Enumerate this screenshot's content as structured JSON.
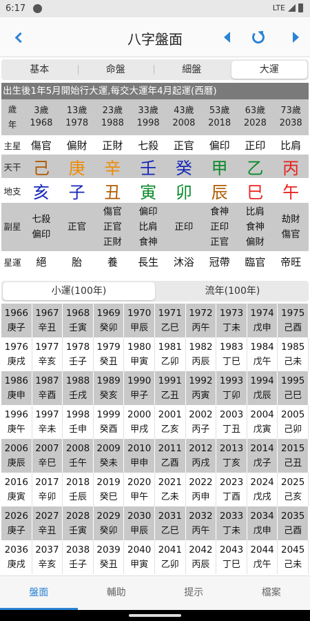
{
  "status": {
    "time": "6:17",
    "network": "LTE"
  },
  "appbar": {
    "title": "八字盤面"
  },
  "tabs": [
    "基本",
    "命盤",
    "細盤",
    "大運"
  ],
  "luck": {
    "header": "出生後1年5月開始行大運,每交大運年4月起運(西曆)",
    "age_label": [
      "歲",
      "年"
    ],
    "ages": [
      {
        "age": "3歲",
        "year": "1968"
      },
      {
        "age": "13歲",
        "year": "1978"
      },
      {
        "age": "23歲",
        "year": "1988"
      },
      {
        "age": "33歲",
        "year": "1998"
      },
      {
        "age": "43歲",
        "year": "2008"
      },
      {
        "age": "53歲",
        "year": "2018"
      },
      {
        "age": "63歲",
        "year": "2028"
      },
      {
        "age": "73歲",
        "year": "2038"
      }
    ],
    "main_label": "主星",
    "main": [
      "傷官",
      "偏財",
      "正財",
      "七殺",
      "正官",
      "偏印",
      "正印",
      "比肩"
    ],
    "stem_label": "天干",
    "stems": [
      {
        "char": "己",
        "color": "#b05a00"
      },
      {
        "char": "庚",
        "color": "#f08a00"
      },
      {
        "char": "辛",
        "color": "#f08a00"
      },
      {
        "char": "壬",
        "color": "#1527b8"
      },
      {
        "char": "癸",
        "color": "#1527b8"
      },
      {
        "char": "甲",
        "color": "#0a8a2a"
      },
      {
        "char": "乙",
        "color": "#0a8a2a"
      },
      {
        "char": "丙",
        "color": "#e8231f"
      }
    ],
    "branch_label": "地支",
    "branches": [
      {
        "char": "亥",
        "color": "#1527b8"
      },
      {
        "char": "子",
        "color": "#1527b8"
      },
      {
        "char": "丑",
        "color": "#b05a00"
      },
      {
        "char": "寅",
        "color": "#0a8a2a"
      },
      {
        "char": "卯",
        "color": "#0a8a2a"
      },
      {
        "char": "辰",
        "color": "#b05a00"
      },
      {
        "char": "巳",
        "color": "#e8231f"
      },
      {
        "char": "午",
        "color": "#e8231f"
      }
    ],
    "sub_label": "副星",
    "sub": [
      [
        "七殺",
        "偏印",
        ""
      ],
      [
        "正官",
        "",
        ""
      ],
      [
        "傷官",
        "正官",
        "正財"
      ],
      [
        "偏印",
        "比肩",
        "食神"
      ],
      [
        "正印",
        "",
        ""
      ],
      [
        "食神",
        "正印",
        "正官"
      ],
      [
        "比肩",
        "食神",
        "偏財"
      ],
      [
        "劫財",
        "傷官",
        ""
      ]
    ],
    "stage_label": "星運",
    "stages": [
      "絕",
      "胎",
      "養",
      "長生",
      "沐浴",
      "冠帶",
      "臨官",
      "帝旺"
    ]
  },
  "subtabs": [
    "小運(100年)",
    "流年(100年)"
  ],
  "years": [
    [
      {
        "y": "1966",
        "gz": "庚子"
      },
      {
        "y": "1967",
        "gz": "辛丑"
      },
      {
        "y": "1968",
        "gz": "壬寅"
      },
      {
        "y": "1969",
        "gz": "癸卯"
      },
      {
        "y": "1970",
        "gz": "甲辰"
      },
      {
        "y": "1971",
        "gz": "乙巳"
      },
      {
        "y": "1972",
        "gz": "丙午"
      },
      {
        "y": "1973",
        "gz": "丁未"
      },
      {
        "y": "1974",
        "gz": "戊申"
      },
      {
        "y": "1975",
        "gz": "己酉"
      }
    ],
    [
      {
        "y": "1976",
        "gz": "庚戌"
      },
      {
        "y": "1977",
        "gz": "辛亥"
      },
      {
        "y": "1978",
        "gz": "壬子"
      },
      {
        "y": "1979",
        "gz": "癸丑"
      },
      {
        "y": "1980",
        "gz": "甲寅"
      },
      {
        "y": "1981",
        "gz": "乙卯"
      },
      {
        "y": "1982",
        "gz": "丙辰"
      },
      {
        "y": "1983",
        "gz": "丁巳"
      },
      {
        "y": "1984",
        "gz": "戊午"
      },
      {
        "y": "1985",
        "gz": "己未"
      }
    ],
    [
      {
        "y": "1986",
        "gz": "庚申"
      },
      {
        "y": "1987",
        "gz": "辛酉"
      },
      {
        "y": "1988",
        "gz": "壬戌"
      },
      {
        "y": "1989",
        "gz": "癸亥"
      },
      {
        "y": "1990",
        "gz": "甲子"
      },
      {
        "y": "1991",
        "gz": "乙丑"
      },
      {
        "y": "1992",
        "gz": "丙寅"
      },
      {
        "y": "1993",
        "gz": "丁卯"
      },
      {
        "y": "1994",
        "gz": "戊辰"
      },
      {
        "y": "1995",
        "gz": "己巳"
      }
    ],
    [
      {
        "y": "1996",
        "gz": "庚午"
      },
      {
        "y": "1997",
        "gz": "辛未"
      },
      {
        "y": "1998",
        "gz": "壬申"
      },
      {
        "y": "1999",
        "gz": "癸酉"
      },
      {
        "y": "2000",
        "gz": "甲戌"
      },
      {
        "y": "2001",
        "gz": "乙亥"
      },
      {
        "y": "2002",
        "gz": "丙子"
      },
      {
        "y": "2003",
        "gz": "丁丑"
      },
      {
        "y": "2004",
        "gz": "戊寅"
      },
      {
        "y": "2005",
        "gz": "己卯"
      }
    ],
    [
      {
        "y": "2006",
        "gz": "庚辰"
      },
      {
        "y": "2007",
        "gz": "辛巳"
      },
      {
        "y": "2008",
        "gz": "壬午"
      },
      {
        "y": "2009",
        "gz": "癸未"
      },
      {
        "y": "2010",
        "gz": "甲申"
      },
      {
        "y": "2011",
        "gz": "乙酉"
      },
      {
        "y": "2012",
        "gz": "丙戌"
      },
      {
        "y": "2013",
        "gz": "丁亥"
      },
      {
        "y": "2014",
        "gz": "戊子"
      },
      {
        "y": "2015",
        "gz": "己丑"
      }
    ],
    [
      {
        "y": "2016",
        "gz": "庚寅"
      },
      {
        "y": "2017",
        "gz": "辛卯"
      },
      {
        "y": "2018",
        "gz": "壬辰"
      },
      {
        "y": "2019",
        "gz": "癸巳"
      },
      {
        "y": "2020",
        "gz": "甲午"
      },
      {
        "y": "2021",
        "gz": "乙未"
      },
      {
        "y": "2022",
        "gz": "丙申"
      },
      {
        "y": "2023",
        "gz": "丁酉"
      },
      {
        "y": "2024",
        "gz": "戊戌"
      },
      {
        "y": "2025",
        "gz": "己亥"
      }
    ],
    [
      {
        "y": "2026",
        "gz": "庚子"
      },
      {
        "y": "2027",
        "gz": "辛丑"
      },
      {
        "y": "2028",
        "gz": "壬寅"
      },
      {
        "y": "2029",
        "gz": "癸卯"
      },
      {
        "y": "2030",
        "gz": "甲辰"
      },
      {
        "y": "2031",
        "gz": "乙巳"
      },
      {
        "y": "2032",
        "gz": "丙午"
      },
      {
        "y": "2033",
        "gz": "丁未"
      },
      {
        "y": "2034",
        "gz": "戊申"
      },
      {
        "y": "2035",
        "gz": "己酉"
      }
    ],
    [
      {
        "y": "2036",
        "gz": "庚戌"
      },
      {
        "y": "2037",
        "gz": "辛亥"
      },
      {
        "y": "2038",
        "gz": "壬子"
      },
      {
        "y": "2039",
        "gz": "癸丑"
      },
      {
        "y": "2040",
        "gz": "甲寅"
      },
      {
        "y": "2041",
        "gz": "乙卯"
      },
      {
        "y": "2042",
        "gz": "丙辰"
      },
      {
        "y": "2043",
        "gz": "丁巳"
      },
      {
        "y": "2044",
        "gz": "戊午"
      },
      {
        "y": "2045",
        "gz": "己未"
      }
    ]
  ],
  "bottomnav": [
    "盤面",
    "輔助",
    "提示",
    "檔案"
  ],
  "colors": {
    "accent": "#2a83d3"
  }
}
